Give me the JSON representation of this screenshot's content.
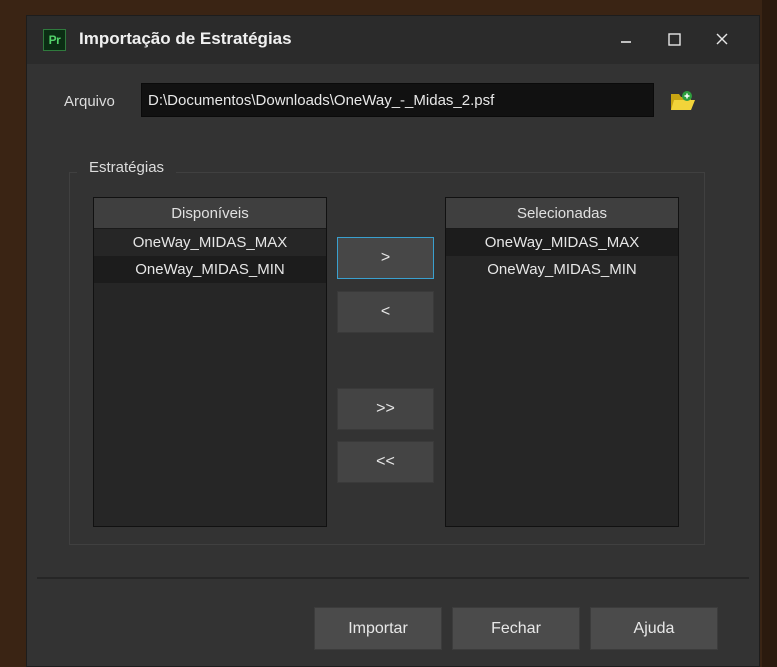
{
  "window": {
    "app_icon_text": "Pr",
    "title": "Importação de Estratégias",
    "minimize_icon": "minimize-icon",
    "maximize_icon": "maximize-icon",
    "close_icon": "close-icon"
  },
  "file": {
    "label": "Arquivo",
    "value": "D:\\Documentos\\Downloads\\OneWay_-_Midas_2.psf",
    "browse_icon": "folder-open-icon"
  },
  "strategies": {
    "group_title": "Estratégias",
    "available": {
      "header": "Disponíveis",
      "items": [
        "OneWay_MIDAS_MAX",
        "OneWay_MIDAS_MIN"
      ]
    },
    "selected": {
      "header": "Selecionadas",
      "items": [
        "OneWay_MIDAS_MAX",
        "OneWay_MIDAS_MIN"
      ]
    },
    "buttons": {
      "add_one": ">",
      "remove_one": "<",
      "add_all": ">>",
      "remove_all": "<<"
    }
  },
  "footer": {
    "import_label": "Importar",
    "close_label": "Fechar",
    "help_label": "Ajuda"
  },
  "colors": {
    "window_bg": "#333333",
    "titlebar_bg": "#2b2b2b",
    "focus_border": "#3aa0cf",
    "folder_icon": "#e8c81c",
    "app_icon_green": "#53d36a"
  }
}
